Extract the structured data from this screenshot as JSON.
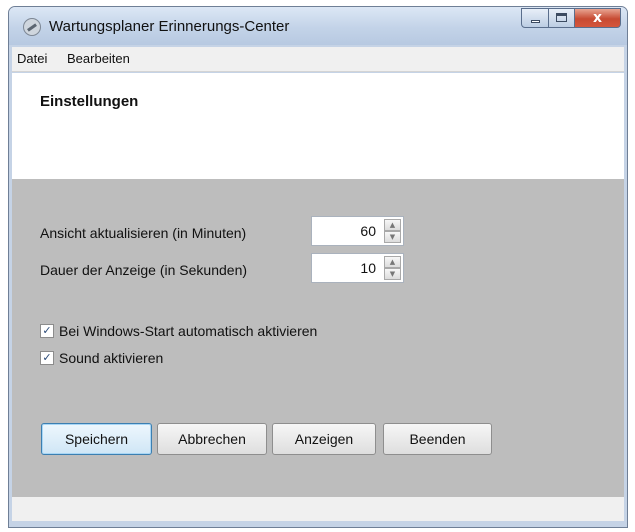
{
  "window": {
    "title": "Wartungsplaner Erinnerungs-Center",
    "icon": "app-wrench-icon"
  },
  "menu": {
    "items": [
      {
        "label": "Datei"
      },
      {
        "label": "Bearbeiten"
      }
    ]
  },
  "header": {
    "title": "Einstellungen"
  },
  "settings": {
    "refresh": {
      "label": "Ansicht aktualisieren  (in Minuten)",
      "value": "60"
    },
    "duration": {
      "label": "Dauer der Anzeige (in Sekunden)",
      "value": "10"
    }
  },
  "options": [
    {
      "label": "Bei Windows-Start automatisch aktivieren",
      "checked": true
    },
    {
      "label": "Sound aktivieren",
      "checked": true
    }
  ],
  "buttons": {
    "save": "Speichern",
    "cancel": "Abbrechen",
    "show": "Anzeigen",
    "quit": "Beenden"
  }
}
